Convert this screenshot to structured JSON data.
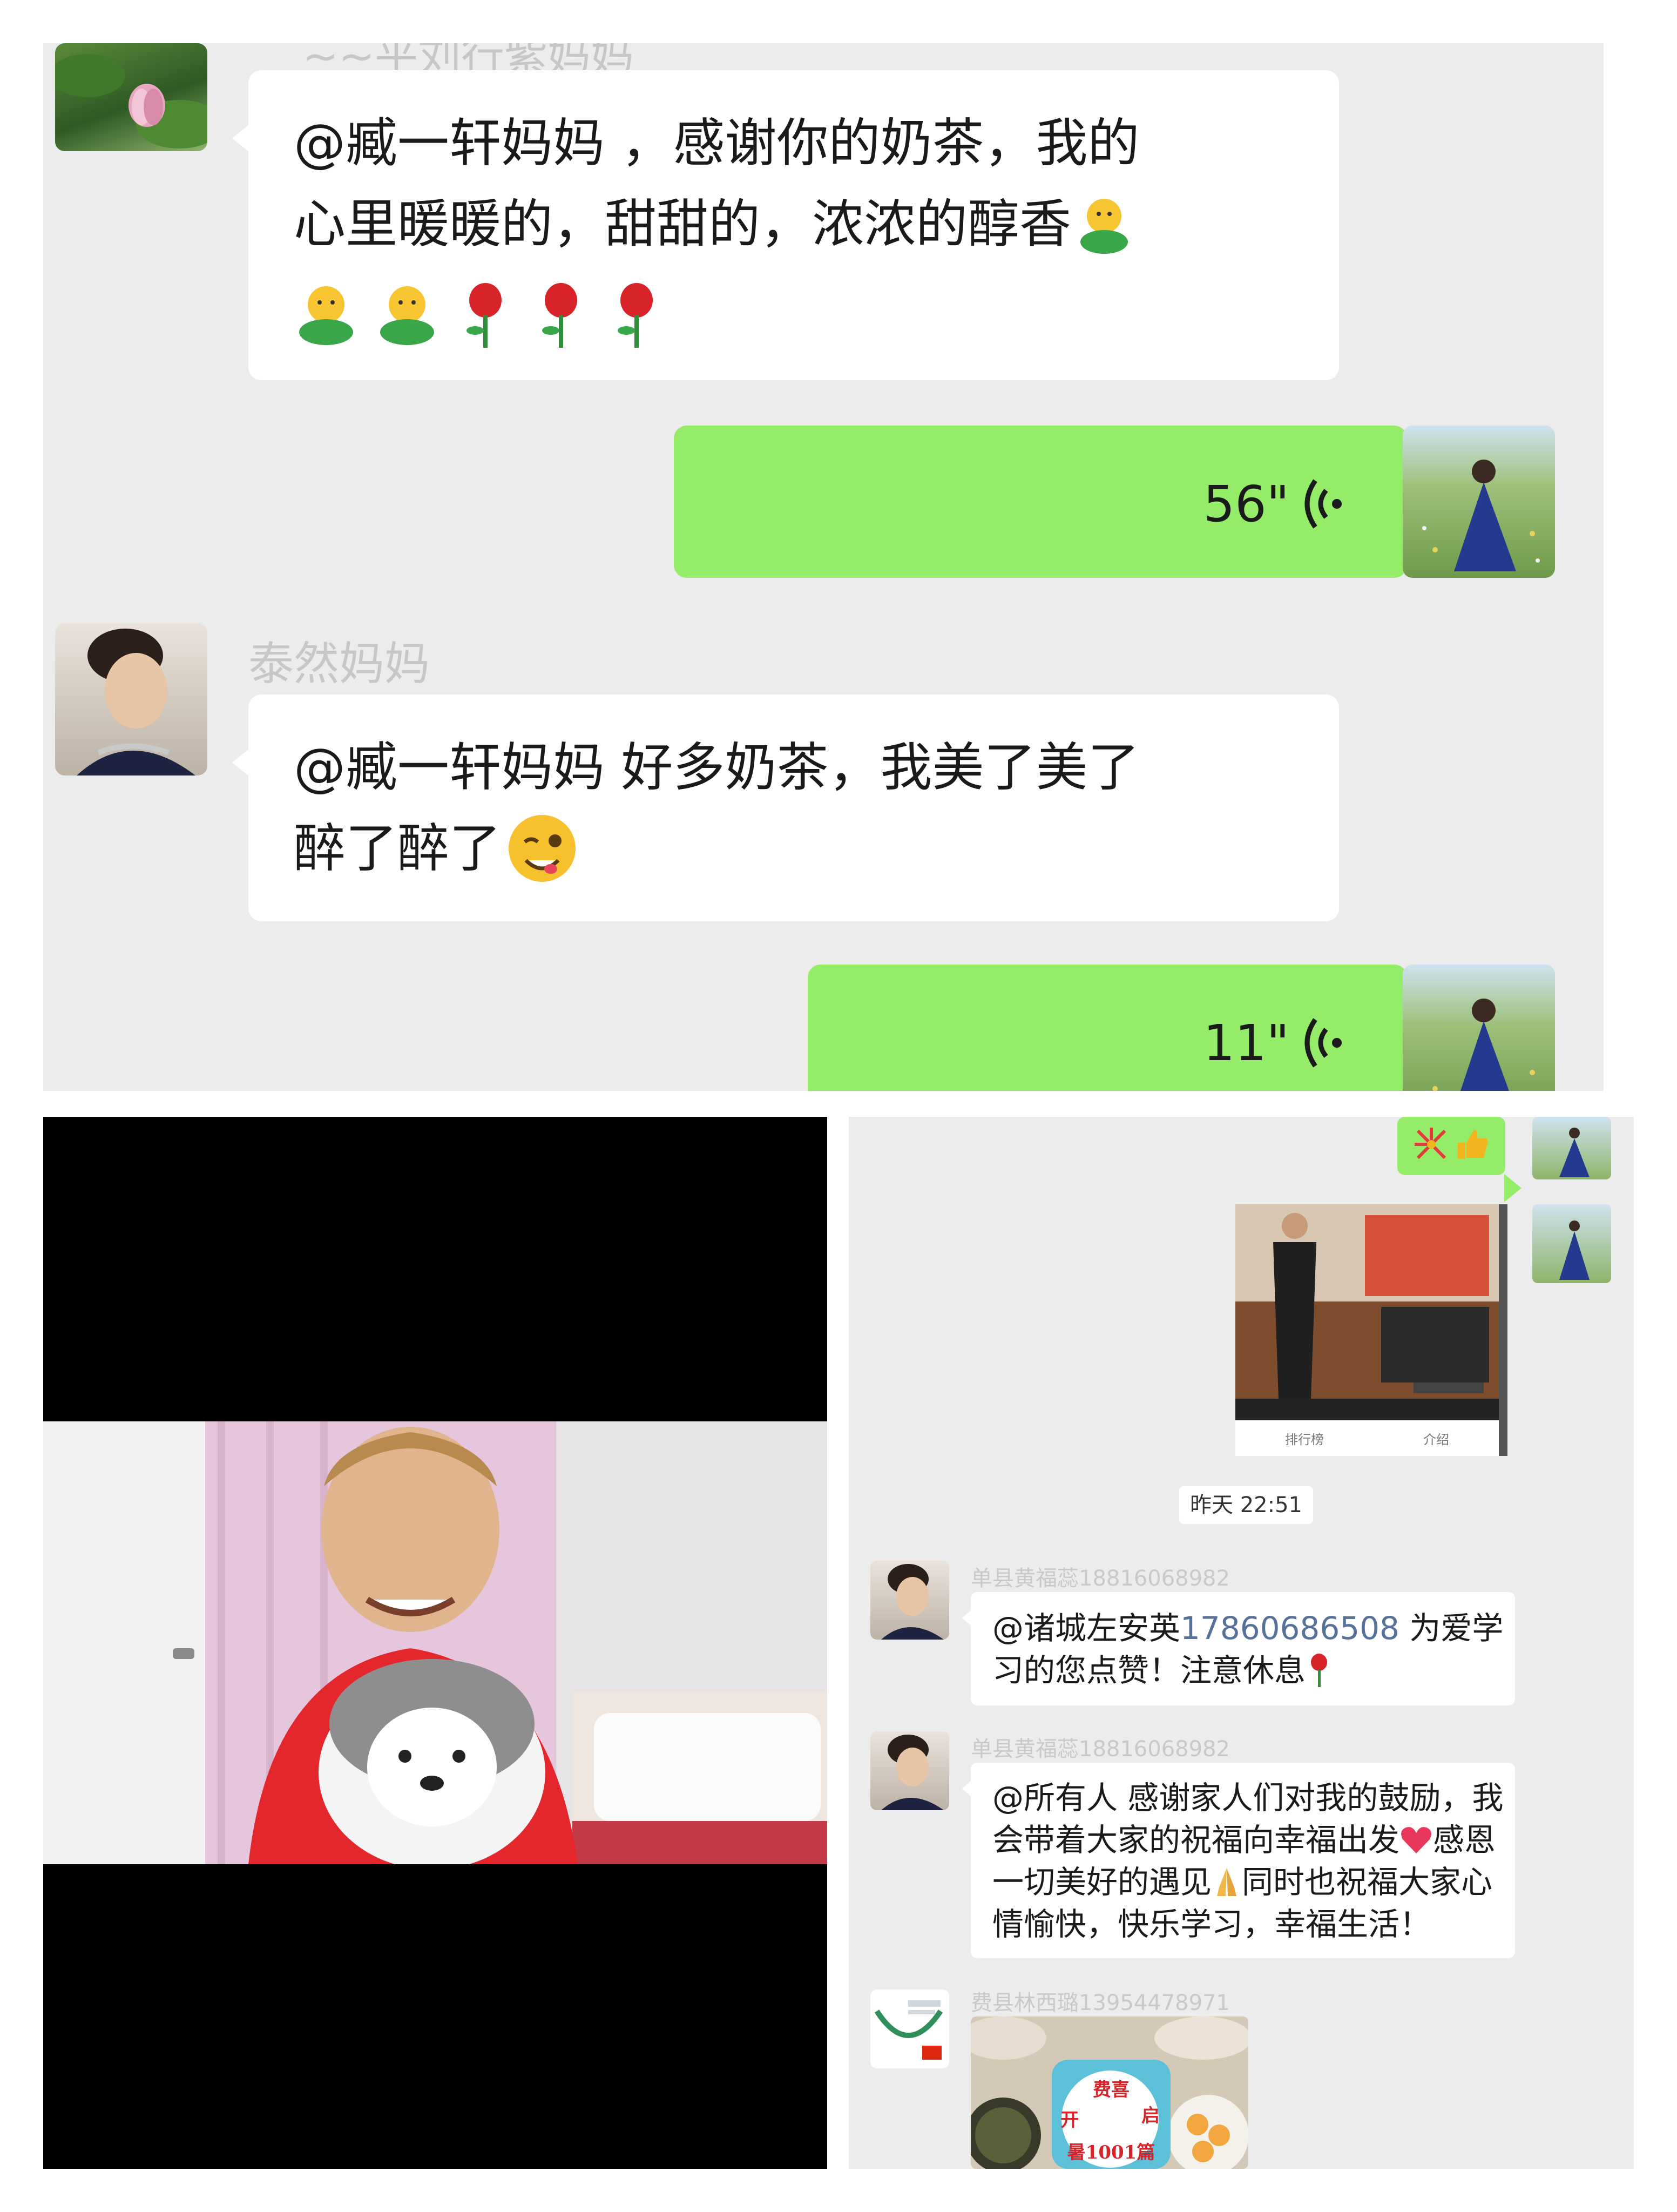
{
  "top_chat": {
    "cutoff_sender": "~~平刘行紫妈妈",
    "msg1": {
      "line1": "@臧一轩妈妈 ，感谢你的奶茶，我的",
      "line2": "心里暖暖的，甜甜的，浓浓的醇香",
      "emoji_names": [
        "hug-emoji",
        "hug-emoji",
        "hug-emoji",
        "rose-emoji",
        "rose-emoji",
        "rose-emoji"
      ]
    },
    "voice1": {
      "duration": "56\""
    },
    "sender2": "泰然妈妈",
    "msg2": {
      "line1": "@臧一轩妈妈  好多奶茶，我美了美了",
      "line2": "醉了醉了"
    },
    "voice2": {
      "duration": "11\""
    }
  },
  "right_chat": {
    "reaction_emojis": [
      "fireworks-emoji",
      "thumbs-up-emoji"
    ],
    "video_thumb": {
      "caption_left": "排行榜",
      "caption_right": "介绍"
    },
    "timestamp": "昨天 22:51",
    "msg_a": {
      "sender": "单县黄福蕊18816068982",
      "mention": "@诸城左安英",
      "phone": "17860686508",
      "rest1": " 为爱学",
      "line2": "习的您点赞！注意休息"
    },
    "msg_b": {
      "sender": "单县黄福蕊18816068982",
      "line1": "@所有人  感谢家人们对我的鼓励，我",
      "line2": "会带着大家的祝福向幸福出发",
      "line2_end": "感恩",
      "line3": "一切美好的遇见",
      "line3_end": "同时也祝福大家心",
      "line4": "情愉快，快乐学习，幸福生活！"
    },
    "msg_c": {
      "sender": "费县林西璐13954478971",
      "cake_text": [
        "费喜",
        "开",
        "启",
        "暑",
        "1001",
        "篇"
      ]
    }
  },
  "colors": {
    "chat_bg": "#ececec",
    "sent_bubble": "#95ec69",
    "received_bubble": "#ffffff",
    "sender_name": "#c7c7c7",
    "phone_link": "#56719a"
  }
}
